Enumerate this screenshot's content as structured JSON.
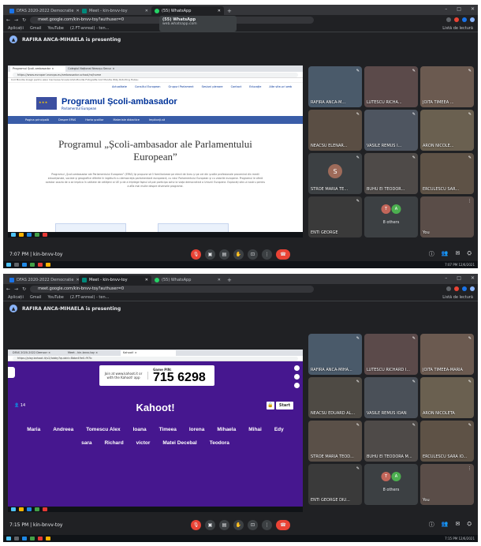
{
  "screen1": {
    "tabs": [
      {
        "label": "DFAS 2020-2022 Democratie",
        "color": "#1a73e8"
      },
      {
        "label": "Meet - kin-bnvv-toy",
        "color": "#00897b"
      },
      {
        "label": "(55) WhatsApp",
        "color": "#25d366"
      }
    ],
    "tooltip": {
      "title": "(55) WhatsApp",
      "url": "web.whatsapp.com"
    },
    "address": "meet.google.com/kin-bnvv-toy?authuser=0",
    "bookmarks": [
      "Aplicații",
      "Gmail",
      "YouTube",
      "(2.FT-anreal) - ten..."
    ],
    "reading_list": "Listă de lectură",
    "presenting": "RAFIRA ANCA-MIHAELA is presenting",
    "presentation": {
      "inner_tabs": [
        "Programul Școli-ambasador ×",
        "Colegiul Național Neacșu Secuc ×"
      ],
      "inner_url": "https://www.europarl.europa.eu/ambassador-school/ro/home",
      "inner_bookmarks": "Cod Moodle   Inregii pentru elevi   Inscrierea Scoala   Ghid-Moodle Fotografie   Cod Moodle   Wiky Rotorting Hubsu",
      "top_links": [
        "Actualitate",
        "Consiliul European",
        "Grupuri Parlament",
        "Sesiuni plenare",
        "Contact",
        "Educație",
        "Alte site-uri web"
      ],
      "site_title": "Programul Școli-ambasador",
      "site_subtitle": "Parlamentul European",
      "nav": [
        "Pagina principală",
        "Despre EPAS",
        "Harta școlilor",
        "Materiale didactice",
        "Implicați-vă"
      ],
      "heading": "Programul „Școli-ambasador ale Parlamentului European”",
      "paragraph": "Programul „Școli-ambasador ale Parlamentului European” (EPAS) își propune să îi familiarizeze pe elevii de liceu și pe cei din școlile profesionale provenind din medii educaționale, sociale și geografice diferite în legătură cu democrația parlamentară europeană, cu rolul Parlamentului European și cu valorile europene. Programul le oferă acestor ocazia de a se implica în calitate de cetățeni ai UE și de a înțelege faptul că pot participa activ la viața democratică a Uniunii Europene. Explorați site-ul nostru pentru a afla mai multe despre diversele programe."
    },
    "participants": [
      {
        "name": "RAFIRA ANCA-M...",
        "bg": "#4a5a6a"
      },
      {
        "name": "LUTESCU RICHA...",
        "bg": "#5b4a4a"
      },
      {
        "name": "JOITA TIMEEA ...",
        "bg": "#6b5a50"
      },
      {
        "name": "NEACSU ELENAR...",
        "bg": "#5a4e44"
      },
      {
        "name": "VASILE REMUS I...",
        "bg": "#4e5560"
      },
      {
        "name": "ARON NICOLE...",
        "bg": "#6a6050"
      },
      {
        "name": "STROE MARIA TE...",
        "bg": "#3c4043",
        "initial": "S",
        "initial_color": "#9e6b5a"
      },
      {
        "name": "BUHU EI TEODOR...",
        "bg": "#4e4a48"
      },
      {
        "name": "ERCULESCU SAR...",
        "bg": "#5e5246"
      },
      {
        "name": "ENTI GEORGE",
        "bg": "#3a3a3a"
      },
      {
        "name": "8 others",
        "bg": "#3c4043",
        "others": [
          "T",
          "A"
        ]
      },
      {
        "name": "You",
        "bg": "#5a4d48"
      }
    ],
    "meeting_info": "7:07 PM  |  kin-bnvv-toy",
    "taskbar_clock": "7:07 PM\n12/6/2021"
  },
  "screen2": {
    "tabs": [
      {
        "label": "DFAS 2020-2022 Democratie",
        "color": "#1a73e8"
      },
      {
        "label": "Meet - kin-bnvv-toy",
        "color": "#00897b"
      },
      {
        "label": "(55) WhatsApp",
        "color": "#25d366"
      }
    ],
    "address": "meet.google.com/kin-bnvv-toy?authuser=0",
    "bookmarks": [
      "Aplicații",
      "Gmail",
      "YouTube",
      "(2.FT-anreal) - ten..."
    ],
    "reading_list": "Listă de lectură",
    "presenting": "RAFIRA ANCA-MIHAELA is presenting",
    "kahoot": {
      "inner_tabs": [
        "DFAS 2020-2022 Democr ×",
        "Meet - kin-bnvv-toy ×",
        "Kahoot! ×"
      ],
      "inner_url": "https://play.kahoot.it/v2/lobby?quizId=8bbe49e0-f97b",
      "join_text": "Join at www.kahoot.it or with the Kahoot! app",
      "pin_label": "Game PIN:",
      "pin": "715 6298",
      "logo": "Kahoot!",
      "player_count": "14",
      "start": "Start",
      "players": [
        "Maria",
        "Andreea",
        "Tomescu Alex",
        "Ioana",
        "Timeea",
        "lorena",
        "Mihaela",
        "Mihai",
        "Edy",
        "sara",
        "Richard",
        "victor",
        "Matei Decebal",
        "Teodora"
      ]
    },
    "participants": [
      {
        "name": "RAFIRA ANCA-MIHA...",
        "bg": "#4a5a6a"
      },
      {
        "name": "LUTESCU RICHARD I...",
        "bg": "#5b4a4a"
      },
      {
        "name": "JOITA TIMEEA-MARIA",
        "bg": "#6b5a50"
      },
      {
        "name": "NEACSU EDUARD AL...",
        "bg": "#4e4a44"
      },
      {
        "name": "VASILE REMUS IOAN",
        "bg": "#4a5058"
      },
      {
        "name": "ARON NICOLETA",
        "bg": "#6a6050"
      },
      {
        "name": "STROE MARIA TEOD...",
        "bg": "#5a5048"
      },
      {
        "name": "BUHU EI TEODORA M...",
        "bg": "#4e4a48"
      },
      {
        "name": "ERCULESCU SARA IO...",
        "bg": "#5e5246"
      },
      {
        "name": "ENTI GEORGE DIU...",
        "bg": "#3a3a3a"
      },
      {
        "name": "8 others",
        "bg": "#3c4043",
        "others": [
          "T",
          "A"
        ]
      },
      {
        "name": "You",
        "bg": "#5a4d48"
      }
    ],
    "meeting_info": "7:15 PM  |  kin-bnvv-toy",
    "taskbar_clock": "7:15 PM\n12/6/2021"
  },
  "colors": {
    "meet_bg": "#202124",
    "accent_red": "#ea4335",
    "kahoot_purple": "#46178f"
  }
}
